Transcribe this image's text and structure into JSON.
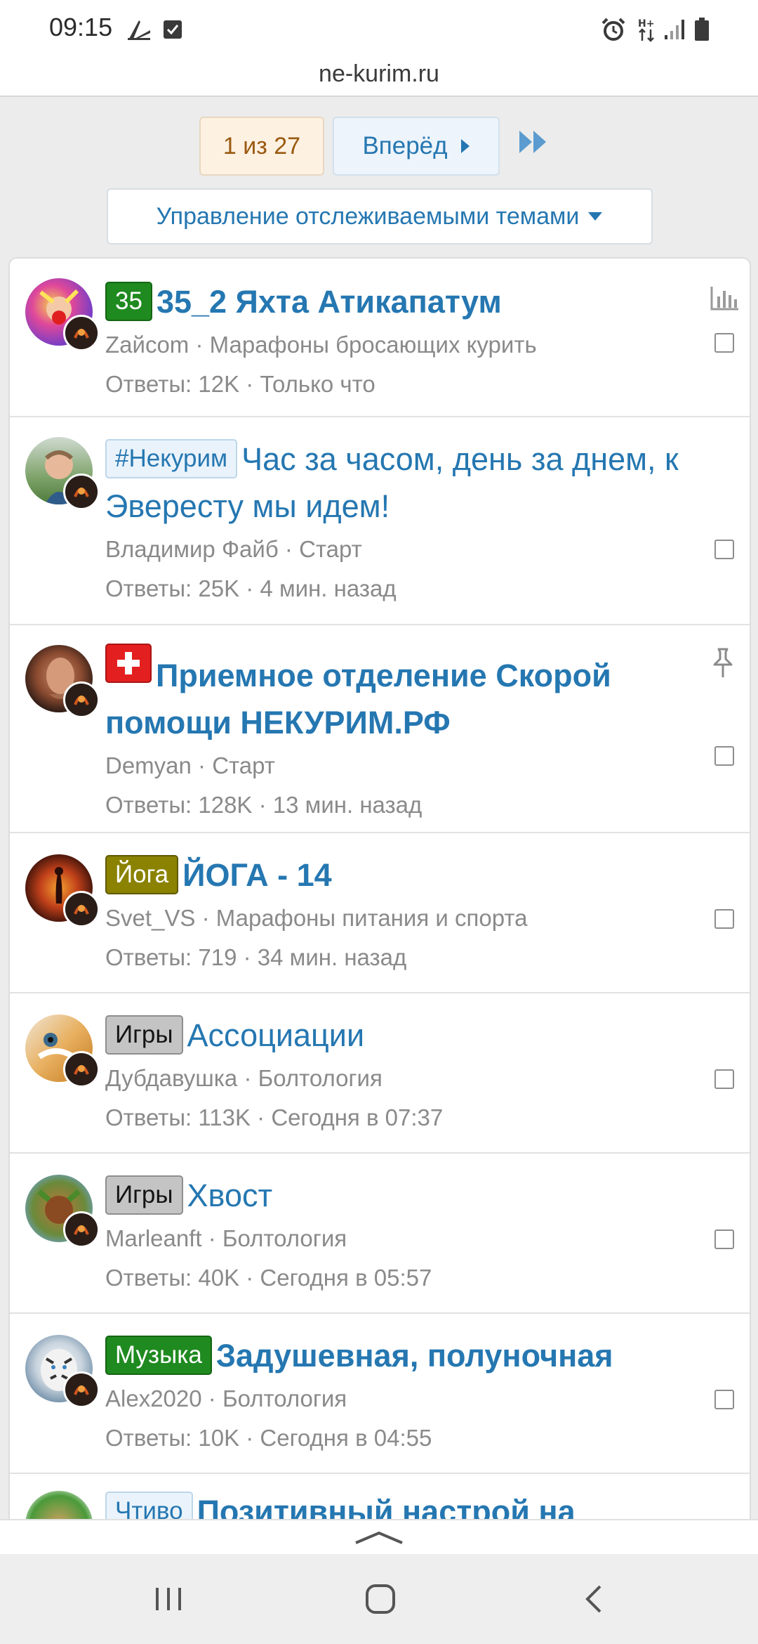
{
  "status": {
    "time": "09:15"
  },
  "url": "ne-kurim.ru",
  "pager": {
    "current": "1 из 27",
    "next": "Вперёд"
  },
  "watch_menu": "Управление отслеживаемыми темами",
  "threads": [
    {
      "tag": "35",
      "tag_style": "green",
      "title": "35_2 Яхта Атикапатум",
      "bold": true,
      "author": "Zaйcom",
      "forum": "Марафоны бросающих курить",
      "replies": "Ответы: 12K",
      "time": "Только что"
    },
    {
      "tag": "#Некурим",
      "tag_style": "blue",
      "title": "Час за часом, день за днем, к Эвересту мы идем!",
      "bold": false,
      "author": "Владимир Файб",
      "forum": "Старт",
      "replies": "Ответы: 25K",
      "time": "4 мин. назад"
    },
    {
      "tag": "",
      "tag_style": "red",
      "title": "Приемное отделение Скорой помощи НЕКУРИМ.РФ",
      "bold": true,
      "author": "Demyan",
      "forum": "Старт",
      "replies": "Ответы: 128K",
      "time": "13 мин. назад"
    },
    {
      "tag": "Йога",
      "tag_style": "olive",
      "title": "ЙОГА - 14",
      "bold": true,
      "author": "Svet_VS",
      "forum": "Марафоны питания и спорта",
      "replies": "Ответы: 719",
      "time": "34 мин. назад"
    },
    {
      "tag": "Игры",
      "tag_style": "gray",
      "title": "Ассоциации",
      "bold": false,
      "author": "Дубдавушка",
      "forum": "Болтология",
      "replies": "Ответы: 113K",
      "time": "Сегодня в 07:37"
    },
    {
      "tag": "Игры",
      "tag_style": "gray",
      "title": "Хвост",
      "bold": false,
      "author": "Marleanft",
      "forum": "Болтология",
      "replies": "Ответы: 40K",
      "time": "Сегодня в 05:57"
    },
    {
      "tag": "Музыка",
      "tag_style": "green",
      "title": "Задушевная, полуночная",
      "bold": true,
      "author": "Alex2020",
      "forum": "Болтология",
      "replies": "Ответы: 10K",
      "time": "Сегодня в 04:55"
    },
    {
      "tag": "Чтиво",
      "tag_style": "blue",
      "title": "Позитивный настрой на",
      "bold": true
    }
  ],
  "separator": " · ",
  "colors": {
    "link": "#2577b1",
    "meta": "#8a8a8a",
    "current_page_bg": "#fdf1e2"
  }
}
